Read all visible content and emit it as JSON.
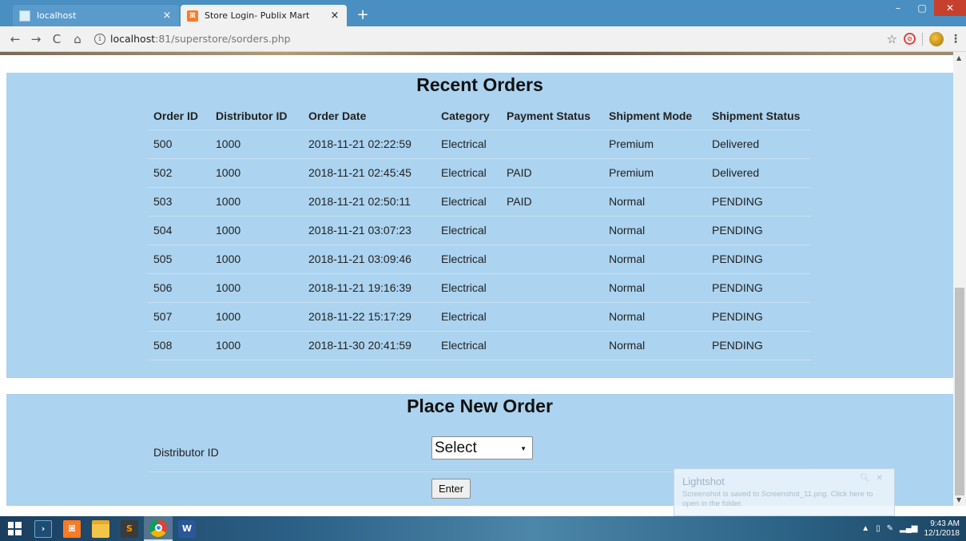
{
  "browser": {
    "tabs": [
      {
        "title": "localhost",
        "active": false
      },
      {
        "title": "Store Login- Publix Mart",
        "active": true
      }
    ],
    "new_tab_symbol": "+",
    "url": {
      "host": "localhost",
      "path": ":81/superstore/sorders.php"
    },
    "window_controls": {
      "minimize": "–",
      "maximize": "▢",
      "close": "✕"
    }
  },
  "recent_orders": {
    "title": "Recent Orders",
    "columns": [
      "Order ID",
      "Distributor ID",
      "Order Date",
      "Category",
      "Payment Status",
      "Shipment Mode",
      "Shipment Status"
    ],
    "rows": [
      [
        "500",
        "1000",
        "2018-11-21 02:22:59",
        "Electrical",
        "",
        "Premium",
        "Delivered"
      ],
      [
        "502",
        "1000",
        "2018-11-21 02:45:45",
        "Electrical",
        "PAID",
        "Premium",
        "Delivered"
      ],
      [
        "503",
        "1000",
        "2018-11-21 02:50:11",
        "Electrical",
        "PAID",
        "Normal",
        "PENDING"
      ],
      [
        "504",
        "1000",
        "2018-11-21 03:07:23",
        "Electrical",
        "",
        "Normal",
        "PENDING"
      ],
      [
        "505",
        "1000",
        "2018-11-21 03:09:46",
        "Electrical",
        "",
        "Normal",
        "PENDING"
      ],
      [
        "506",
        "1000",
        "2018-11-21 19:16:39",
        "Electrical",
        "",
        "Normal",
        "PENDING"
      ],
      [
        "507",
        "1000",
        "2018-11-22 15:17:29",
        "Electrical",
        "",
        "Normal",
        "PENDING"
      ],
      [
        "508",
        "1000",
        "2018-11-30 20:41:59",
        "Electrical",
        "",
        "Normal",
        "PENDING"
      ]
    ]
  },
  "new_order": {
    "title": "Place New Order",
    "distributor_label": "Distributor ID",
    "select_value": "Select",
    "enter_label": "Enter"
  },
  "lightshot": {
    "title": "Lightshot",
    "message": "Screenshot is saved to Screenshot_11.png. Click here to open in the folder."
  },
  "taskbar": {
    "time": "9:43 AM",
    "date": "12/1/2018",
    "apps": [
      "windows-start",
      "vscode",
      "xampp",
      "file-explorer",
      "sublime-text",
      "chrome",
      "word"
    ]
  },
  "colors": {
    "panel_bg": "#acd3ef",
    "tabstrip_bg": "#4a8fc1",
    "close_button": "#c7402e"
  }
}
